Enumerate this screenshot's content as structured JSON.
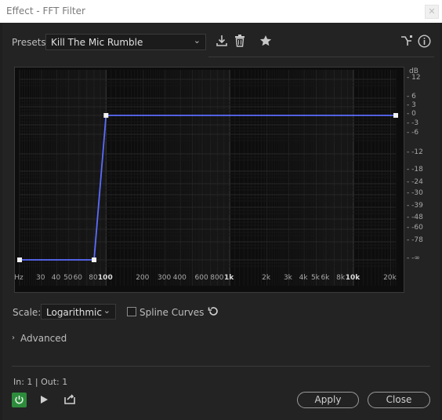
{
  "window": {
    "title": "Effect - FFT Filter",
    "close_glyph": "✕"
  },
  "presets": {
    "label": "Presets:",
    "value": "Kill The Mic Rumble",
    "icons": [
      "save-preset-icon",
      "delete-preset-icon",
      "favorite-star-icon",
      "routing-icon",
      "info-icon"
    ]
  },
  "graph": {
    "y_unit": "dB",
    "y_ticks": [
      "12",
      "6",
      "3",
      "0",
      "-3",
      "-6",
      "-12",
      "-18",
      "-24",
      "-30",
      "-39",
      "-48",
      "-60",
      "-78",
      "-∞"
    ],
    "x_unit": "Hz",
    "x_ticks": [
      "30",
      "40",
      "50",
      "60",
      "80",
      "100",
      "200",
      "300",
      "400",
      "600",
      "800",
      "1k",
      "2k",
      "3k",
      "4k",
      "5k",
      "6k",
      "8k",
      "10k",
      "20k"
    ],
    "x_major": [
      "100",
      "1k",
      "10k"
    ]
  },
  "chart_data": {
    "type": "line",
    "series": [
      {
        "x": [
          20,
          80,
          100,
          22000
        ],
        "y": [
          "-∞",
          "-∞",
          0,
          0
        ]
      }
    ],
    "x_scale": "log",
    "x_unit": "Hz",
    "y_unit": "dB",
    "grid": true
  },
  "controls": {
    "scale_label": "Scale:",
    "scale_value": "Logarithmic",
    "spline_label": "Spline Curves",
    "spline_checked": false,
    "advanced_label": "Advanced"
  },
  "footer": {
    "io": "In: 1 | Out: 1",
    "apply_label": "Apply",
    "close_label": "Close"
  },
  "colors": {
    "curve": "#5b6cff",
    "power_on": "#2d8c3c"
  }
}
